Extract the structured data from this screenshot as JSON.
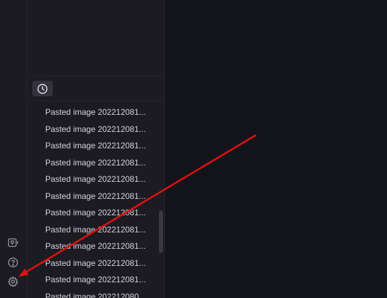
{
  "colors": {
    "background": "#13131a",
    "sidebar": "#1c1b22",
    "text": "#d6d4dd",
    "icon": "#9a99a3",
    "annotation_arrow": "#e01010"
  },
  "ribbon": {
    "icons": [
      "vault-switcher-icon",
      "help-icon",
      "settings-gear-icon"
    ]
  },
  "sidebar": {
    "recent_tab_icon": "clock-icon",
    "files": [
      "Pasted image 202212081...",
      "Pasted image 202212081...",
      "Pasted image 202212081...",
      "Pasted image 202212081...",
      "Pasted image 202212081...",
      "Pasted image 202212081...",
      "Pasted image 202212081...",
      "Pasted image 202212081...",
      "Pasted image 202212081...",
      "Pasted image 202212081...",
      "Pasted image 202212081...",
      "Pasted image 202212080..."
    ]
  },
  "annotation": {
    "type": "arrow",
    "points_to": "settings-gear-icon"
  }
}
